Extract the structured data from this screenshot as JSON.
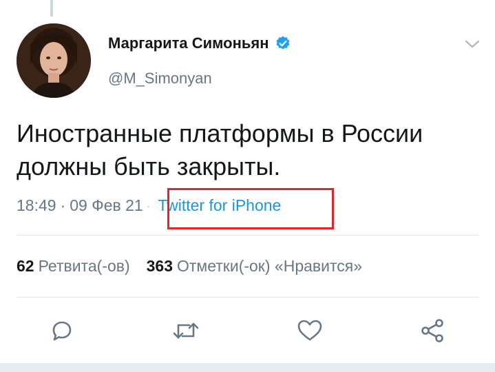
{
  "tweet": {
    "display_name": "Маргарита Симоньян",
    "handle": "@M_Simonyan",
    "text": "Иностранные платформы в России должны быть закрыты.",
    "time": "18:49",
    "date": "09 Фев 21",
    "separator": "·",
    "source": "Twitter for iPhone"
  },
  "stats": {
    "retweets_count": "62",
    "retweets_label": "Ретвита(-ов)",
    "likes_count": "363",
    "likes_label": "Отметки(-ок) «Нравится»"
  },
  "actions": {
    "icons": [
      "reply-icon",
      "retweet-icon",
      "like-icon",
      "share-icon"
    ]
  },
  "colors": {
    "text": "#14171a",
    "secondary": "#657786",
    "link": "#1b95e0",
    "verified": "#1da1f2",
    "highlight": "#e0262b",
    "divider": "#e1e8ed"
  }
}
